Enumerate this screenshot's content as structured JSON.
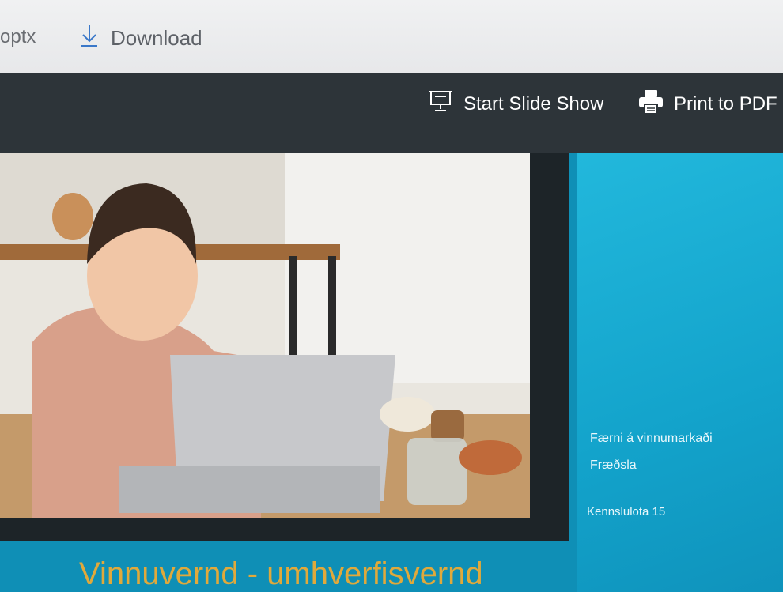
{
  "topbar": {
    "filename_fragment": "optx",
    "download_label": "Download"
  },
  "toolbar": {
    "slideshow_label": "Start Slide Show",
    "print_label": "Print to PDF"
  },
  "slide": {
    "subtitle_line1": "Færni á vinnumarkaði",
    "subtitle_line2": "Fræðsla",
    "lesson": "Kennslulota 15",
    "title": "Vinnuvernd - umhverfisvernd"
  },
  "colors": {
    "toolbar_bg": "#2d3439",
    "slide_accent": "#16a6cb",
    "title_color": "#e0a93b"
  }
}
